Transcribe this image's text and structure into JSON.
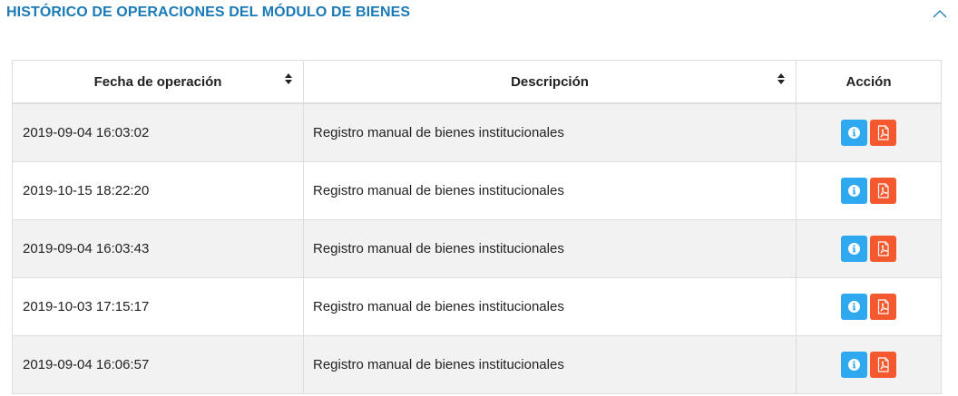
{
  "panel": {
    "title": "HISTÓRICO DE OPERACIONES DEL MÓDULO DE BIENES",
    "accent_color": "#1a7ab8",
    "toggle_icon": "chevron-up-icon"
  },
  "table": {
    "columns": [
      {
        "label": "Fecha de operación",
        "sortable": true
      },
      {
        "label": "Descripción",
        "sortable": true
      },
      {
        "label": "Acción",
        "sortable": false
      }
    ],
    "rows": [
      {
        "date": "2019-09-04 16:03:02",
        "description": "Registro manual de bienes institucionales"
      },
      {
        "date": "2019-10-15 18:22:20",
        "description": "Registro manual de bienes institucionales"
      },
      {
        "date": "2019-09-04 16:03:43",
        "description": "Registro manual de bienes institucionales"
      },
      {
        "date": "2019-10-03 17:15:17",
        "description": "Registro manual de bienes institucionales"
      },
      {
        "date": "2019-09-04 16:06:57",
        "description": "Registro manual de bienes institucionales"
      }
    ],
    "action_icons": [
      "info-icon",
      "pdf-icon"
    ],
    "colors": {
      "info_button": "#2ea9f0",
      "pdf_button": "#f4582e",
      "stripe": "#f2f2f2"
    }
  }
}
